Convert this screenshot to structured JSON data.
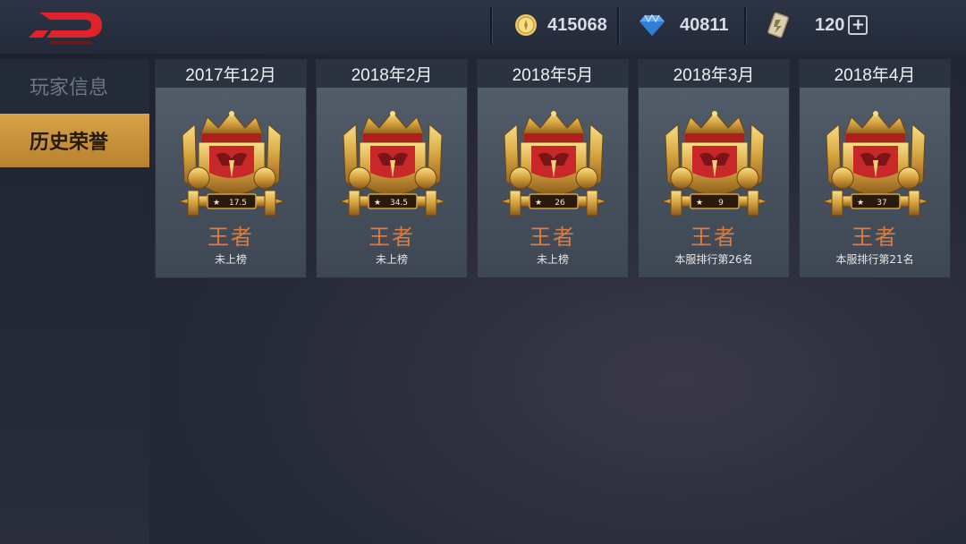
{
  "header": {
    "resources": [
      {
        "icon": "gold-coin-icon",
        "value": "415068"
      },
      {
        "icon": "diamond-icon",
        "value": "40811"
      },
      {
        "icon": "voucher-icon",
        "value": "120"
      }
    ]
  },
  "sidebar": {
    "items": [
      {
        "label": "玩家信息",
        "active": false
      },
      {
        "label": "历史荣誉",
        "active": true
      }
    ]
  },
  "honors": [
    {
      "season": "2017年12月",
      "stars": "17.5",
      "rank": "王者",
      "status": "未上榜"
    },
    {
      "season": "2018年2月",
      "stars": "34.5",
      "rank": "王者",
      "status": "未上榜"
    },
    {
      "season": "2018年5月",
      "stars": "26",
      "rank": "王者",
      "status": "未上榜"
    },
    {
      "season": "2018年3月",
      "stars": "9",
      "rank": "王者",
      "status": "本服排行第26名"
    },
    {
      "season": "2018年4月",
      "stars": "37",
      "rank": "王者",
      "status": "本服排行第21名"
    }
  ],
  "colors": {
    "accent": "#e07a3a",
    "active_tab": "#c9913a",
    "back_red": "#e0232a"
  }
}
